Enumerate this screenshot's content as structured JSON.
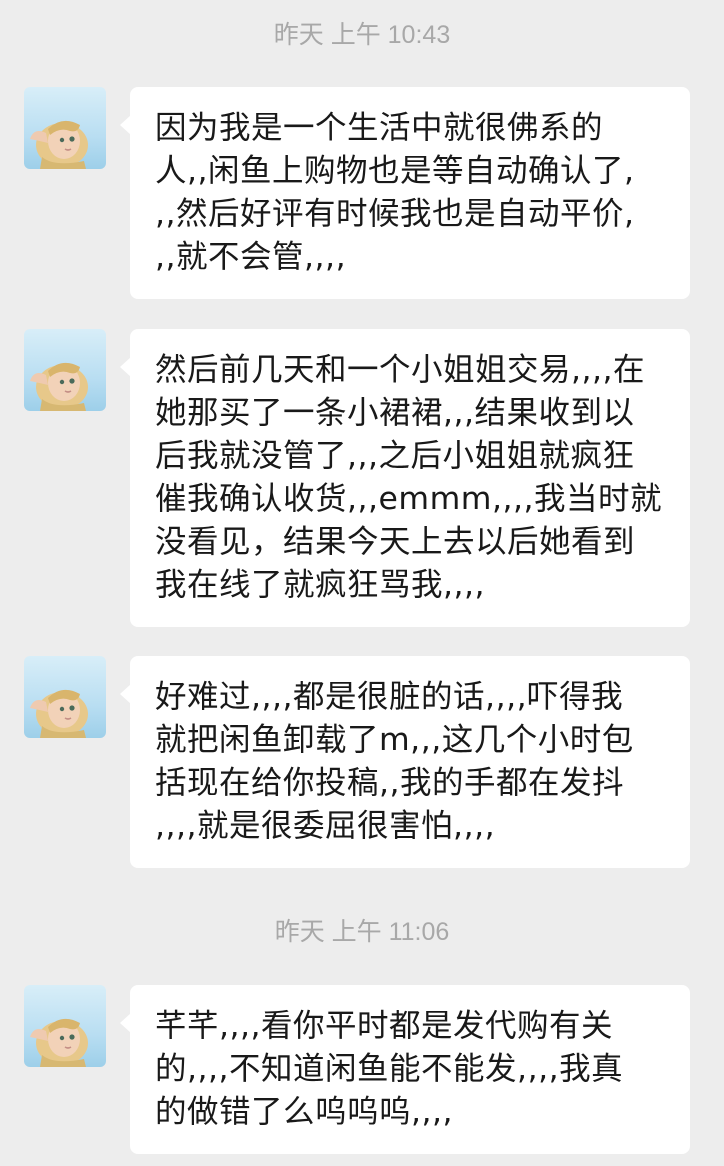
{
  "timestamps": [
    "昨天 上午 10:43",
    "昨天 上午 11:06"
  ],
  "messages": [
    {
      "avatar_icon": "elf-avatar-icon",
      "text": "因为我是一个生活中就很佛系的\n人,,闲鱼上购物也是等自动确认了,\n,,然后好评有时候我也是自动平价,\n,,就不会管,,,,"
    },
    {
      "avatar_icon": "elf-avatar-icon",
      "text": "然后前几天和一个小姐姐交易,,,,在\n她那买了一条小裙裙,,,结果收到以\n后我就没管了,,,之后小姐姐就疯狂\n催我确认收货,,,emmm,,,,我当时就\n没看见，结果今天上去以后她看到\n我在线了就疯狂骂我,,,,"
    },
    {
      "avatar_icon": "elf-avatar-icon",
      "text": "好难过,,,,都是很脏的话,,,,吓得我\n就把闲鱼卸载了m,,,这几个小时包\n括现在给你投稿,,我的手都在发抖\n,,,,就是很委屈很害怕,,,,"
    },
    {
      "avatar_icon": "elf-avatar-icon",
      "text": "芊芊,,,,看你平时都是发代购有关\n的,,,,不知道闲鱼能不能发,,,,我真\n的做错了么呜呜呜,,,,"
    }
  ],
  "colors": {
    "background": "#ededed",
    "bubble": "#ffffff",
    "text": "#191919",
    "timestamp": "#a8a8a8"
  }
}
